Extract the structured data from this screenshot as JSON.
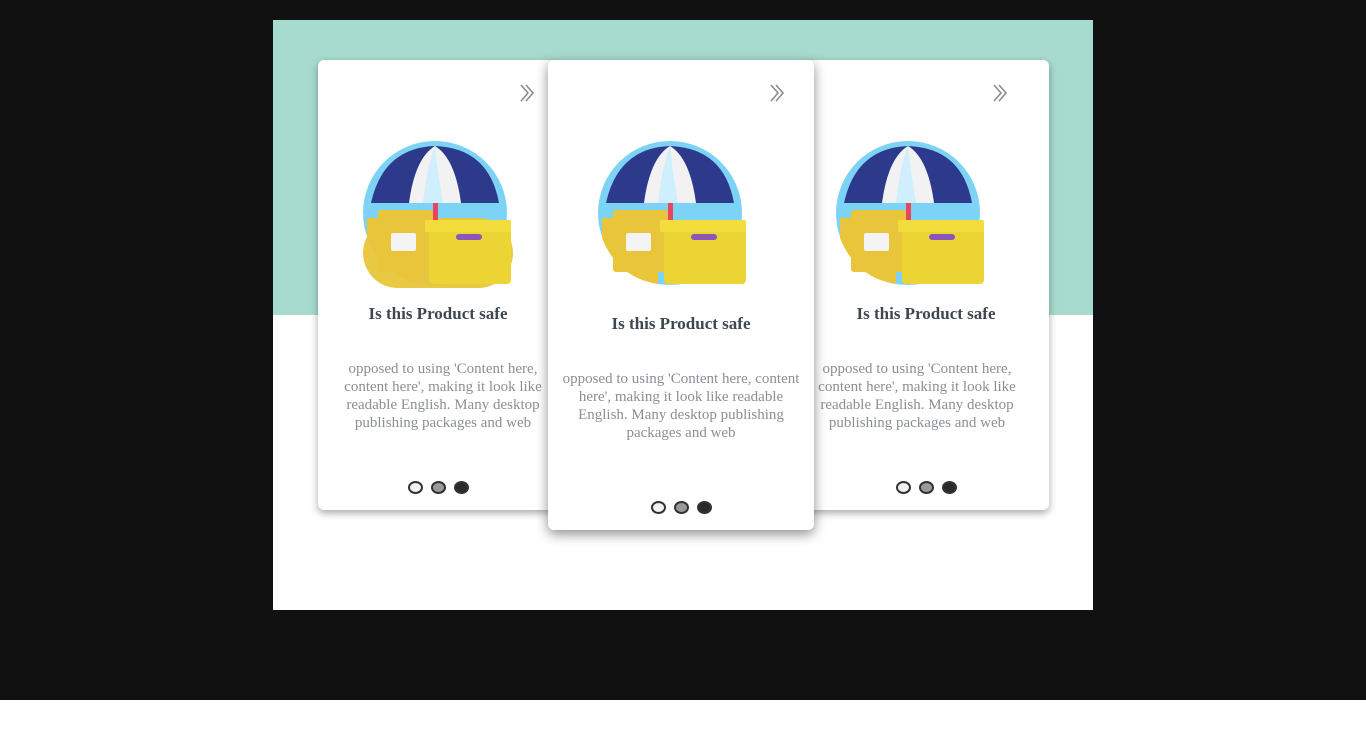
{
  "slider": {
    "cards": [
      {
        "position": "left",
        "title": "Is this Product safe",
        "text": "opposed to using 'Content here, content here', making it look like readable English. Many desktop publishing packages and web",
        "icon": "product-safety-umbrella-boxes-icon"
      },
      {
        "position": "center",
        "title": "Is this Product safe",
        "text": "opposed to using 'Content here, content here', making it look like readable English. Many desktop publishing packages and web",
        "icon": "product-safety-umbrella-boxes-icon"
      },
      {
        "position": "right",
        "title": "Is this Product safe",
        "text": "opposed to using 'Content here, content here', making it look like readable English. Many desktop publishing packages and web",
        "icon": "product-safety-umbrella-boxes-icon"
      }
    ],
    "pagination_count": 3,
    "next_icon": "double-chevron-right-icon"
  },
  "colors": {
    "page_background": "#111111",
    "band": "#a8dbcf",
    "card": "#ffffff",
    "title": "#3e474f",
    "text": "#8a8f96"
  }
}
